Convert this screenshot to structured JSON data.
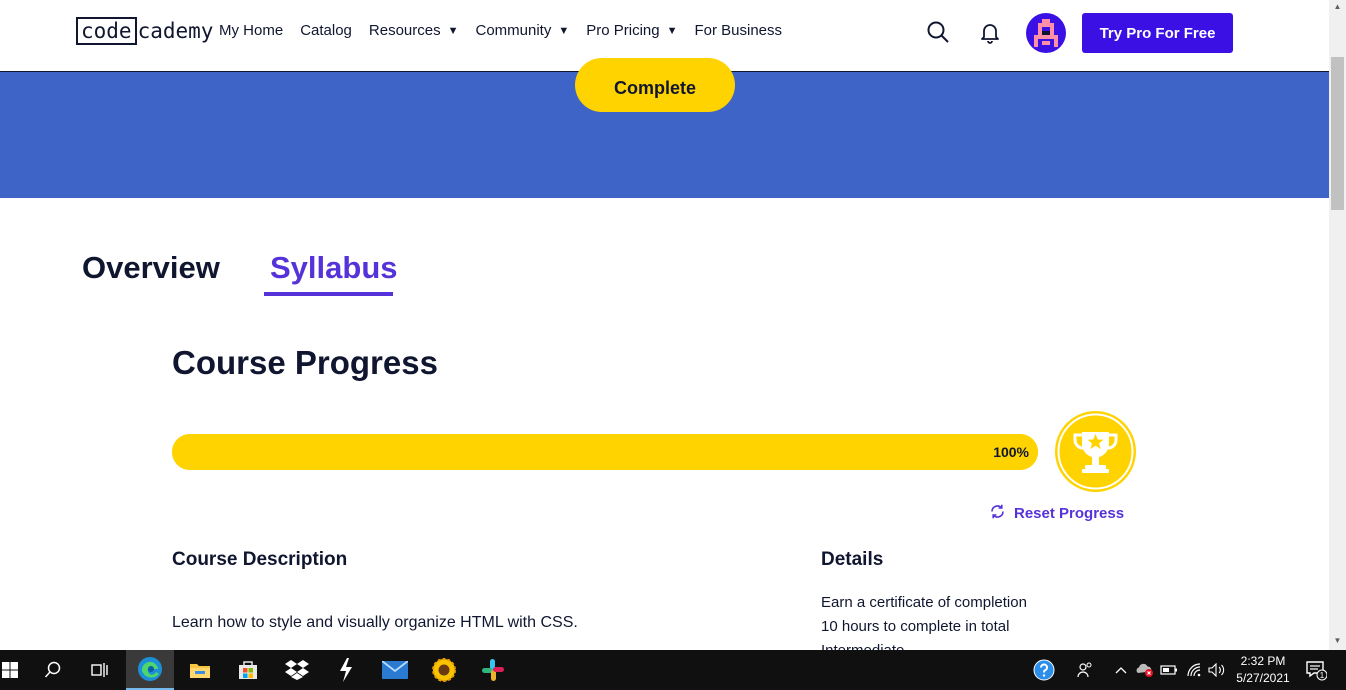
{
  "header": {
    "logo_code": "code",
    "logo_rest": "cademy",
    "nav": [
      {
        "label": "My Home",
        "has_caret": false
      },
      {
        "label": "Catalog",
        "has_caret": false
      },
      {
        "label": "Resources",
        "has_caret": true
      },
      {
        "label": "Community",
        "has_caret": true
      },
      {
        "label": "Pro Pricing",
        "has_caret": true
      },
      {
        "label": "For Business",
        "has_caret": false
      }
    ],
    "caret_glyph": "▼",
    "try_pro_label": "Try Pro For Free",
    "accent_color": "#3a10e5"
  },
  "hero": {
    "complete_label": "Complete",
    "band_color": "#3d64c6",
    "button_color": "#ffd300"
  },
  "tabs": {
    "overview": "Overview",
    "syllabus": "Syllabus",
    "active": "syllabus"
  },
  "progress": {
    "title": "Course Progress",
    "percent_label": "100%",
    "fraction": 1.0,
    "reset_label": "Reset Progress"
  },
  "course": {
    "description_title": "Course Description",
    "description": "Learn how to style and visually organize HTML with CSS.",
    "details_title": "Details",
    "details": [
      "Earn a certificate of completion",
      "10 hours to complete in total",
      "Intermediate"
    ]
  },
  "taskbar": {
    "time": "2:32 PM",
    "date": "5/27/2021",
    "notification_count": "1"
  }
}
